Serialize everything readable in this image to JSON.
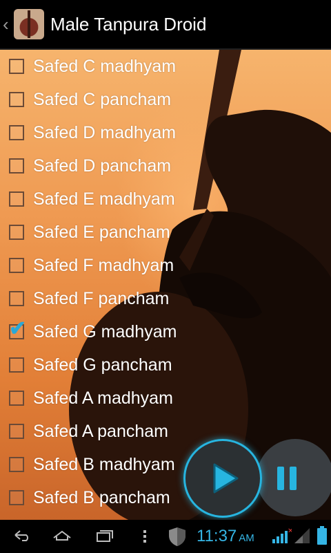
{
  "app": {
    "title": "Male Tanpura Droid",
    "up_icon": "chevron-left-icon",
    "app_icon": "tanpura-icon"
  },
  "list": {
    "items": [
      {
        "label": "Safed C madhyam",
        "checked": false
      },
      {
        "label": "Safed C pancham",
        "checked": false
      },
      {
        "label": "Safed D madhyam",
        "checked": false
      },
      {
        "label": "Safed D pancham",
        "checked": false
      },
      {
        "label": "Safed E madhyam",
        "checked": false
      },
      {
        "label": "Safed E pancham",
        "checked": false
      },
      {
        "label": "Safed F madhyam",
        "checked": false
      },
      {
        "label": "Safed F pancham",
        "checked": false
      },
      {
        "label": "Safed G madhyam",
        "checked": true
      },
      {
        "label": "Safed G pancham",
        "checked": false
      },
      {
        "label": "Safed A madhyam",
        "checked": false
      },
      {
        "label": "Safed A pancham",
        "checked": false
      },
      {
        "label": "Safed B madhyam",
        "checked": false
      },
      {
        "label": "Safed B pancham",
        "checked": false
      }
    ]
  },
  "controls": {
    "play_icon": "play-icon",
    "pause_icon": "pause-icon",
    "accent": "#27b5e0"
  },
  "status": {
    "time": "11:37",
    "ampm": "AM",
    "icons": [
      "back-icon",
      "home-icon",
      "recent-apps-icon",
      "menu-icon",
      "shield-icon",
      "wifi-icon",
      "signal-icon",
      "battery-icon"
    ]
  }
}
